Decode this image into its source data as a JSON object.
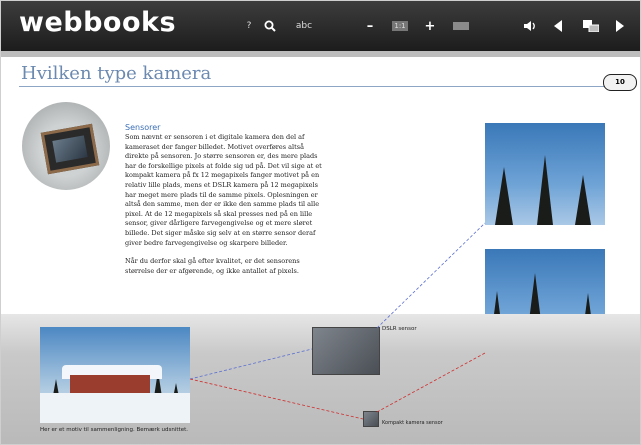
{
  "app": {
    "logo": "webbooks"
  },
  "toolbar": {
    "help": "?",
    "text_tool": "abc",
    "zoom_out": "–",
    "zoom_level": "1:1",
    "zoom_in": "+"
  },
  "page": {
    "title": "Hvilken type kamera",
    "number": "10"
  },
  "article": {
    "heading": "Sensorer",
    "paragraphs": [
      "Som nævnt er sensoren i et digitale kamera den del af kameraset der fanger billedet. Motivet overføres altså direkte på sensoren. Jo større sensoren er, des mere plads har de forskellige pixels at folde sig ud på. Det vil sige at et kompakt kamera på fx 12 megapixels fanger motivet på en relativ lille plads, mens et DSLR kamera på 12 megapixels har meget mere plads til de samme pixels. Oplesningen er altså den samme, men der er ikke den samme plads til alle pixel. At de 12 megapixels så skal presses ned på en lille sensor, giver dårligere farvegengivelse og et mere sløret billede. Det siger måske sig selv at en større sensor deraf giver bedre farvegengivelse og skarpere billeder.",
      "Når du derfor skal gå efter kvalitet, er det sensorens størrelse der er afgørende, og ikke antallet af pixels."
    ]
  },
  "figure": {
    "dslr_label": "DSLR sensor",
    "compact_label": "Kompakt kamera sensor",
    "caption": "Her er et motiv til sammenligning. Bemærk udsnittet."
  },
  "colors": {
    "toolbar": "#2a2a2a",
    "title": "#6c89b0",
    "heading": "#3b6fb5",
    "dslr_line": "#5b6fd0",
    "compact_line": "#d02c2c"
  },
  "icons": [
    "search-icon",
    "speaker-icon",
    "prev-page-icon",
    "page-layout-icon",
    "next-page-icon"
  ]
}
